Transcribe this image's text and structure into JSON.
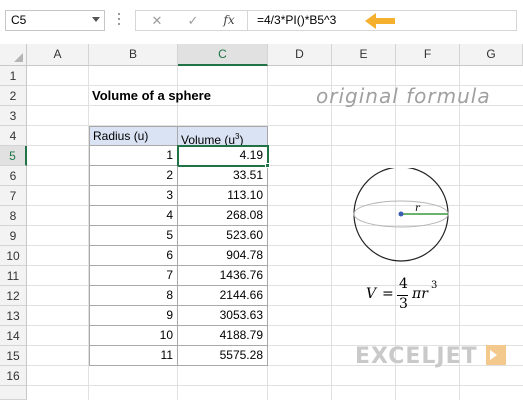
{
  "formula_bar": {
    "name_box": "C5",
    "cancel_icon": "✕",
    "enter_icon": "✓",
    "fx_label": "fx",
    "formula": "=4/3*PI()*B5^3",
    "arrow_color": "#f5b02e"
  },
  "columns": [
    "A",
    "B",
    "C",
    "D",
    "E",
    "F",
    "G"
  ],
  "rows": [
    "1",
    "2",
    "3",
    "4",
    "5",
    "6",
    "7",
    "8",
    "9",
    "10",
    "11",
    "12",
    "13",
    "14",
    "15",
    "16"
  ],
  "selected": {
    "column": "C",
    "row": "5"
  },
  "sheet": {
    "title": "Volume of a sphere",
    "table": {
      "header_radius": "Radius (u)",
      "header_volume": "Volume (u",
      "header_volume_sup": "3",
      "header_volume_close": ")",
      "rows": [
        {
          "radius": "1",
          "volume": "4.19"
        },
        {
          "radius": "2",
          "volume": "33.51"
        },
        {
          "radius": "3",
          "volume": "113.10"
        },
        {
          "radius": "4",
          "volume": "268.08"
        },
        {
          "radius": "5",
          "volume": "523.60"
        },
        {
          "radius": "6",
          "volume": "904.78"
        },
        {
          "radius": "7",
          "volume": "1436.76"
        },
        {
          "radius": "8",
          "volume": "2144.66"
        },
        {
          "radius": "9",
          "volume": "3053.63"
        },
        {
          "radius": "10",
          "volume": "4188.79"
        },
        {
          "radius": "11",
          "volume": "5575.28"
        }
      ]
    },
    "annotation": "original formula",
    "sphere_label": "r",
    "formula_lhs": "V",
    "formula_eq": "=",
    "formula_num": "4",
    "formula_den": "3",
    "formula_rhs": "πr",
    "formula_exp": "3",
    "logo": "EXCELJET",
    "colors": {
      "accent": "#217346",
      "header_fill": "#dae3f3",
      "radius_line": "#3a9a3a",
      "center_dot": "#3a5fb0"
    }
  }
}
